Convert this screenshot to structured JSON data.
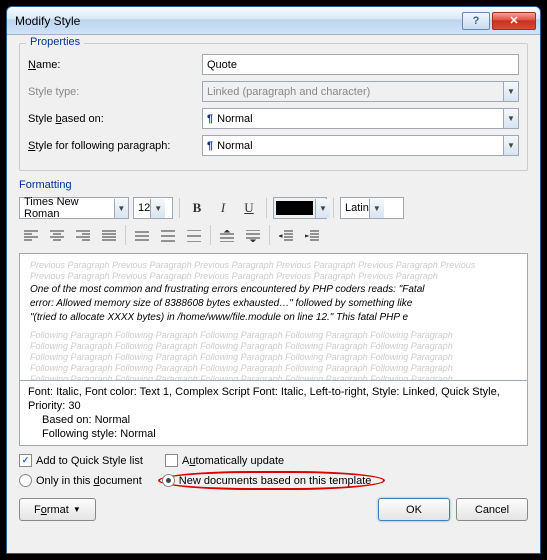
{
  "title": "Modify Style",
  "properties": {
    "group_label": "Properties",
    "name_label": "Name:",
    "name_value": "Quote",
    "type_label": "Style type:",
    "type_value": "Linked (paragraph and character)",
    "based_label": "Style based on:",
    "based_value": "Normal",
    "following_label": "Style for following paragraph:",
    "following_value": "Normal"
  },
  "formatting": {
    "label": "Formatting",
    "font": "Times New Roman",
    "size": "12",
    "script": "Latin",
    "preview_gray": "Previous Paragraph Previous Paragraph Previous Paragraph Previous Paragraph Previous Paragraph Previous",
    "preview_gray2": "Previous Paragraph Previous Paragraph Previous Paragraph Previous Paragraph Previous Paragraph",
    "preview_main1": "One of the most common and frustrating errors encountered by PHP coders reads: \"Fatal",
    "preview_main2": "error: Allowed memory size of 8388608 bytes exhausted…\" followed by something like",
    "preview_main3": "\"(tried to allocate XXXX bytes) in /home/www/file.module on line 12.\" This fatal PHP e",
    "follow_gray": "Following Paragraph Following Paragraph Following Paragraph Following Paragraph Following Paragraph",
    "desc1": "Font: Italic, Font color: Text 1, Complex Script Font: Italic, Left-to-right, Style: Linked, Quick Style,",
    "desc2": "Priority: 30",
    "desc3": "Based on: Normal",
    "desc4": "Following style: Normal"
  },
  "options": {
    "quickstyle": "Add to Quick Style list",
    "autoupdate": "Automatically update",
    "onlydoc": "Only in this document",
    "newdocs": "New documents based on this template"
  },
  "buttons": {
    "format": "Format",
    "ok": "OK",
    "cancel": "Cancel"
  }
}
